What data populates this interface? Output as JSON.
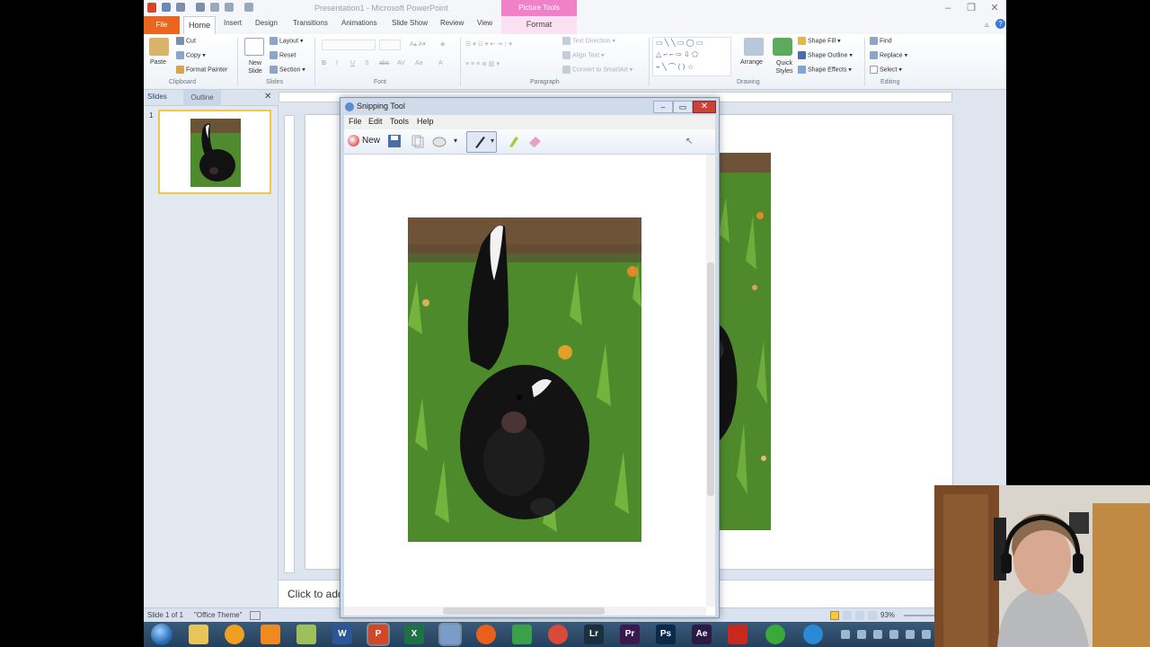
{
  "powerpoint": {
    "title": "Presentation1 - Microsoft PowerPoint",
    "picture_tools": "Picture Tools",
    "tabs": [
      "File",
      "Home",
      "Insert",
      "Design",
      "Transitions",
      "Animations",
      "Slide Show",
      "Review",
      "View",
      "Format"
    ],
    "ribbon": {
      "clipboard": {
        "paste": "Paste",
        "cut": "Cut",
        "copy": "Copy",
        "format_painter": "Format Painter",
        "label": "Clipboard"
      },
      "slides": {
        "new_slide": "New Slide",
        "layout": "Layout",
        "reset": "Reset",
        "section": "Section",
        "label": "Slides"
      },
      "font": {
        "label": "Font",
        "buttons": [
          "B",
          "I",
          "U",
          "S",
          "abc",
          "AV",
          "Aa",
          "A"
        ]
      },
      "paragraph": {
        "label": "Paragraph",
        "text_direction": "Text Direction",
        "align_text": "Align Text",
        "convert_smartart": "Convert to SmartArt"
      },
      "drawing": {
        "arrange": "Arrange",
        "quick_styles": "Quick Styles",
        "shape_fill": "Shape Fill",
        "shape_outline": "Shape Outline",
        "shape_effects": "Shape Effects",
        "label": "Drawing"
      },
      "editing": {
        "find": "Find",
        "replace": "Replace",
        "select": "Select",
        "label": "Editing"
      }
    },
    "pane": {
      "slides_tab": "Slides",
      "outline_tab": "Outline",
      "slide_number": "1"
    },
    "notes_placeholder": "Click to add notes",
    "status": {
      "slide": "Slide 1 of 1",
      "theme": "\"Office Theme\"",
      "zoom": "93%"
    }
  },
  "snipping_tool": {
    "title": "Snipping Tool",
    "menu": [
      "File",
      "Edit",
      "Tools",
      "Help"
    ],
    "toolbar": {
      "new_label": "New"
    }
  },
  "taskbar": {
    "apps": [
      {
        "name": "word",
        "glyph": "W",
        "color": "#2b5797"
      },
      {
        "name": "powerpoint",
        "glyph": "P",
        "color": "#d24726"
      },
      {
        "name": "excel",
        "glyph": "X",
        "color": "#1e7145"
      },
      {
        "name": "lightroom",
        "glyph": "Lr",
        "color": "#1c2f3f"
      },
      {
        "name": "premiere",
        "glyph": "Pr",
        "color": "#3a1a4e"
      },
      {
        "name": "photoshop",
        "glyph": "Ps",
        "color": "#0b2a4a"
      },
      {
        "name": "after-effects",
        "glyph": "Ae",
        "color": "#2b1a46"
      }
    ]
  },
  "colors": {
    "file_tab": "#e96520",
    "picture_tools": "#f080c8",
    "snip_close": "#c9423a"
  }
}
